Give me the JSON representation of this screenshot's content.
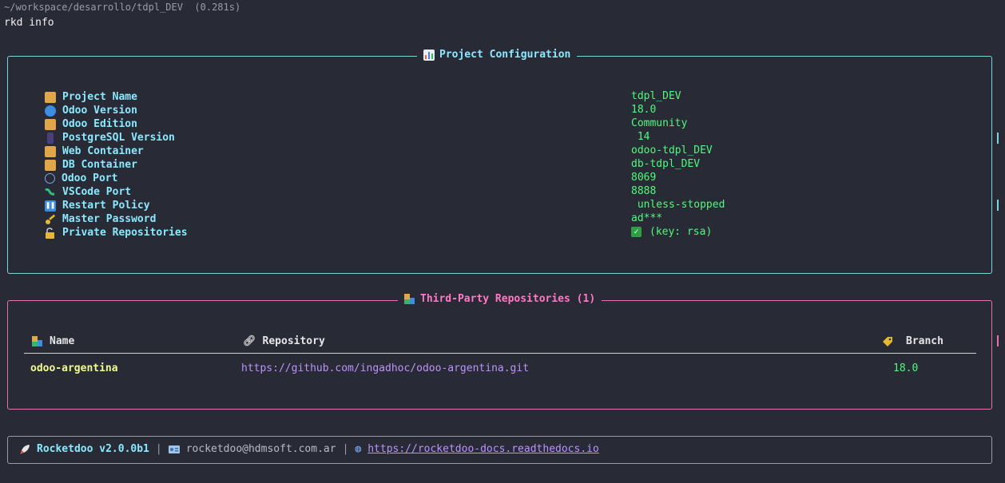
{
  "terminal": {
    "prompt_path": "~/workspace/desarrollo/tdpl_DEV  (0.281s)",
    "command": "rkd info"
  },
  "config_panel": {
    "title": "Project Configuration",
    "title_icon": "bar-chart-icon",
    "rows": [
      {
        "icon": "package-icon",
        "label": "Project Name",
        "value": "tdpl_DEV"
      },
      {
        "icon": "globe-icon",
        "label": "Odoo Version",
        "value": "18.0"
      },
      {
        "icon": "package-icon",
        "label": "Odoo Edition",
        "value": "Community"
      },
      {
        "icon": "database-icon",
        "label": " PostgreSQL Version",
        "value": " 14"
      },
      {
        "icon": "package-icon",
        "label": "Web Container",
        "value": "odoo-tdpl_DEV"
      },
      {
        "icon": "package-icon",
        "label": "DB Container",
        "value": "db-tdpl_DEV"
      },
      {
        "icon": "network-icon",
        "label": "Odoo Port",
        "value": "8069"
      },
      {
        "icon": "vscode-icon",
        "label": "VSCode Port",
        "value": "8888"
      },
      {
        "icon": "pause-icon",
        "label": "Restart Policy",
        "value": " unless-stopped"
      },
      {
        "icon": "key-icon",
        "label": "Master Password",
        "value": "ad***"
      },
      {
        "icon": "unlock-icon",
        "label": "Private Repositories",
        "value": "(key: rsa)",
        "check": true
      }
    ]
  },
  "repo_panel": {
    "title": "Third-Party Repositories (1)",
    "title_icon": "blocks-icon",
    "headers": {
      "name": "Name",
      "repository": "Repository",
      "branch": "Branch"
    },
    "rows": [
      {
        "name": "odoo-argentina",
        "repository": "https://github.com/ingadhoc/odoo-argentina.git",
        "branch": "18.0"
      }
    ]
  },
  "footer": {
    "brand": "Rocketdoo v2.0.0b1",
    "email": "rocketdoo@hdmsoft.com.ar",
    "docs_url": "https://rocketdoo-docs.readthedocs.io",
    "separator": "|"
  },
  "colors": {
    "background": "#282a36",
    "cyan": "#8be9fd",
    "pink": "#ff79c6",
    "green": "#50fa7b",
    "yellow": "#f1fa8c",
    "purple": "#bd93f9"
  }
}
